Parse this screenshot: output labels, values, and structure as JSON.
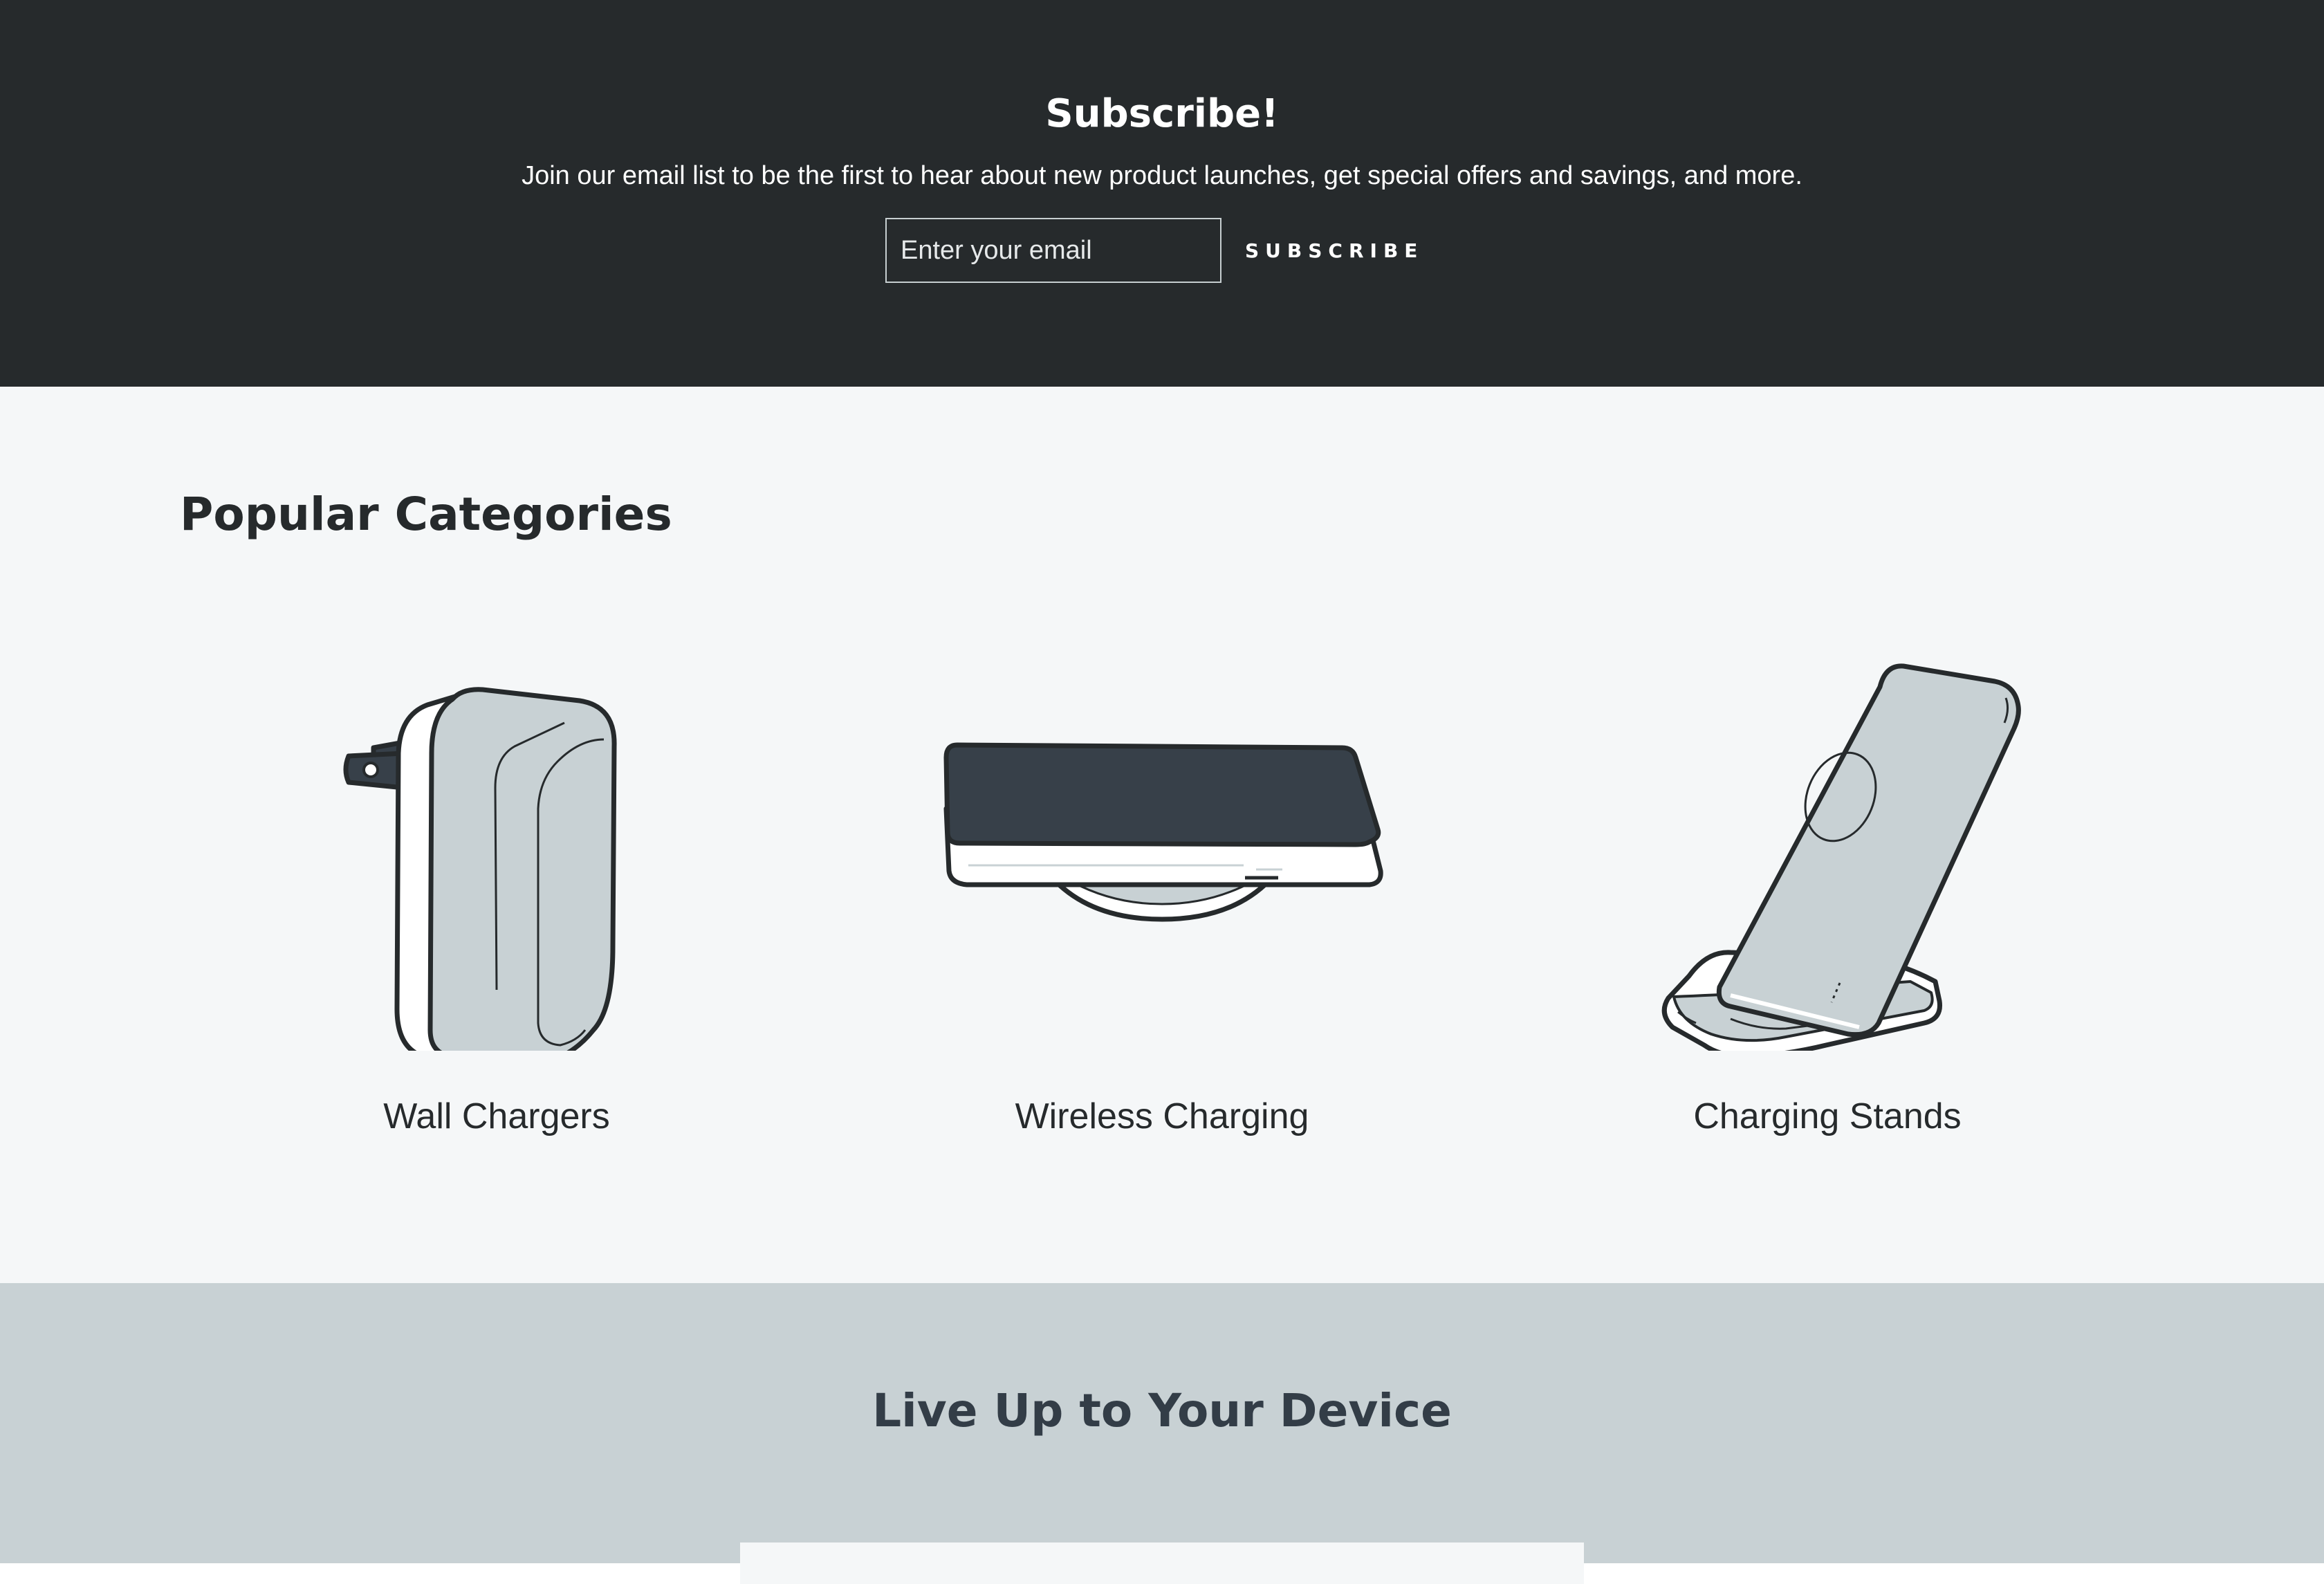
{
  "subscribe": {
    "title": "Subscribe!",
    "description": "Join our email list to be the first to hear about new product launches, get special offers and savings, and more.",
    "email_placeholder": "Enter your email",
    "button_label": "SUBSCRIBE"
  },
  "categories": {
    "heading": "Popular Categories",
    "items": [
      {
        "label": "Wall Chargers",
        "icon": "wall-charger-icon"
      },
      {
        "label": "Wireless Charging",
        "icon": "wireless-charging-pad-icon"
      },
      {
        "label": "Charging Stands",
        "icon": "charging-stand-icon"
      }
    ]
  },
  "device_section": {
    "heading": "Live Up to Your Device"
  },
  "colors": {
    "dark_band": "#262a2c",
    "light_band": "#f5f7f8",
    "gray_band": "#c8d1d4",
    "illustration_fill": "#c8d1d4",
    "pad_dark": "#374049",
    "heading_dark": "#333d47"
  }
}
